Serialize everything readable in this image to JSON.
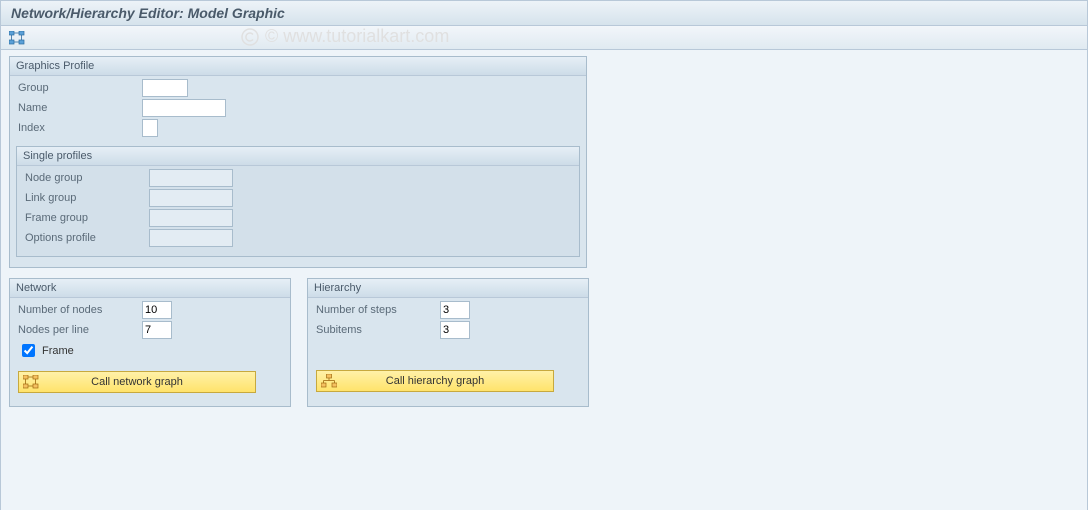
{
  "title": "Network/Hierarchy Editor: Model Graphic",
  "watermark": "© www.tutorialkart.com",
  "graphics_profile": {
    "title": "Graphics Profile",
    "group_label": "Group",
    "group_value": "",
    "name_label": "Name",
    "name_value": "",
    "index_label": "Index",
    "index_value": ""
  },
  "single_profiles": {
    "title": "Single profiles",
    "node_group_label": "Node group",
    "node_group_value": "",
    "link_group_label": "Link group",
    "link_group_value": "",
    "frame_group_label": "Frame group",
    "frame_group_value": "",
    "options_profile_label": "Options profile",
    "options_profile_value": ""
  },
  "network": {
    "title": "Network",
    "nodes_label": "Number of nodes",
    "nodes_value": "10",
    "per_line_label": "Nodes per line",
    "per_line_value": "7",
    "frame_label": "Frame",
    "frame_checked": true,
    "button_label": "Call network graph"
  },
  "hierarchy": {
    "title": "Hierarchy",
    "steps_label": "Number of steps",
    "steps_value": "3",
    "subitems_label": "Subitems",
    "subitems_value": "3",
    "button_label": "Call hierarchy graph"
  }
}
